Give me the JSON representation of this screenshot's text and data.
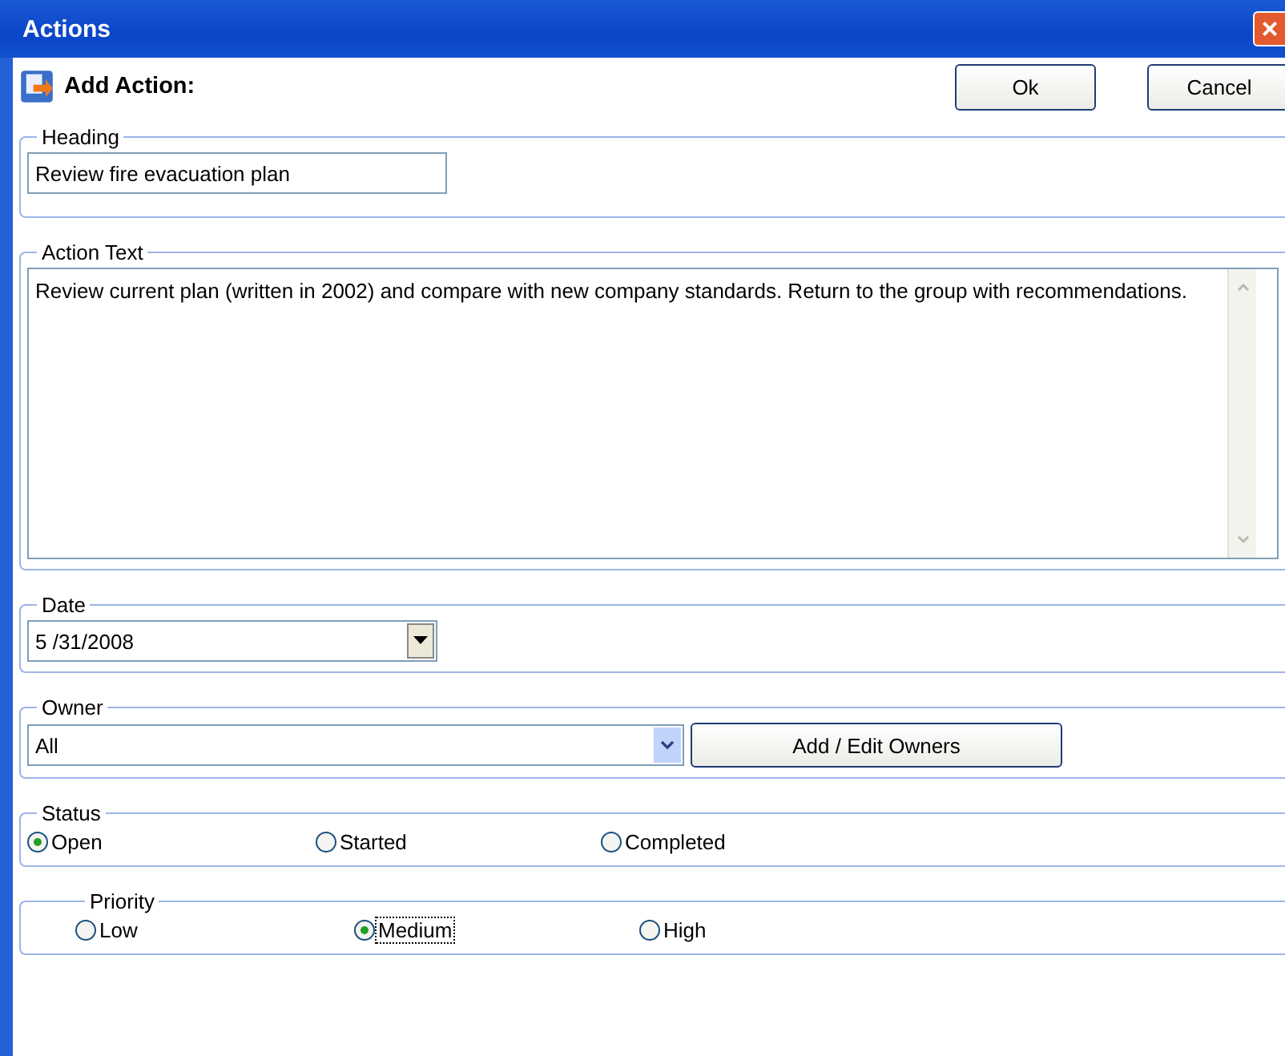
{
  "window": {
    "title": "Actions",
    "close": "×"
  },
  "header": {
    "title": "Add Action:"
  },
  "buttons": [
    {
      "label": "Ok"
    },
    {
      "label": "Cancel"
    }
  ],
  "heading": {
    "label": "Heading",
    "value": "Review fire evacuation plan"
  },
  "action_text": {
    "label": "Action Text",
    "value": "Review current plan (written in 2002) and compare with new company standards. Return to the group with recommendations."
  },
  "date": {
    "label": "Date",
    "value": "5 /31/2008"
  },
  "owner": {
    "label": "Owner",
    "value": "All",
    "button": "Add / Edit Owners"
  },
  "status": {
    "label": "Status",
    "options": [
      {
        "label": "Open",
        "selected": true
      },
      {
        "label": "Started",
        "selected": false
      },
      {
        "label": "Completed",
        "selected": false
      }
    ]
  },
  "priority": {
    "label": "Priority",
    "options": [
      {
        "label": "Low",
        "selected": false,
        "focused": false
      },
      {
        "label": "Medium",
        "selected": true,
        "focused": true
      },
      {
        "label": "High",
        "selected": false,
        "focused": false
      }
    ]
  }
}
